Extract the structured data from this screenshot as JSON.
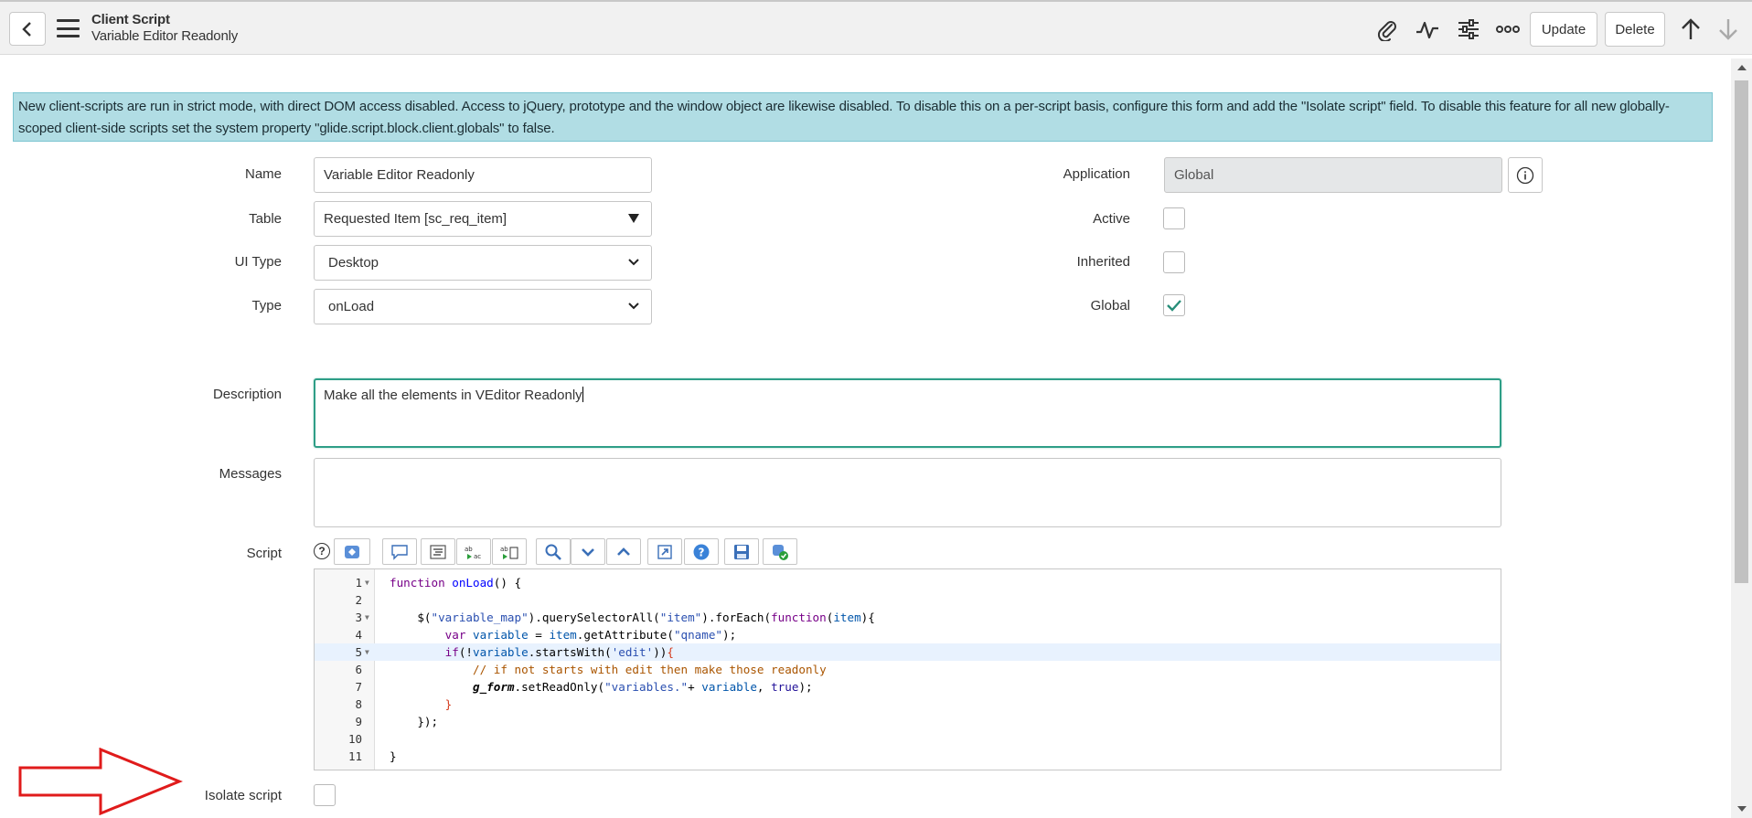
{
  "header": {
    "record_type": "Client Script",
    "record_name": "Variable Editor Readonly",
    "update_label": "Update",
    "delete_label": "Delete"
  },
  "banner": {
    "text": "New client-scripts are run in strict mode, with direct DOM access disabled. Access to jQuery, prototype and the window object are likewise disabled. To disable this on a per-script basis, configure this form and add the \"Isolate script\" field. To disable this feature for all new globally-scoped client-side scripts set the system property \"glide.script.block.client.globals\" to false."
  },
  "form": {
    "name": {
      "label": "Name",
      "value": "Variable Editor Readonly"
    },
    "table": {
      "label": "Table",
      "value": "Requested Item [sc_req_item]"
    },
    "ui_type": {
      "label": "UI Type",
      "value": "Desktop"
    },
    "type": {
      "label": "Type",
      "value": "onLoad"
    },
    "application": {
      "label": "Application",
      "value": "Global"
    },
    "active": {
      "label": "Active",
      "checked": false
    },
    "inherited": {
      "label": "Inherited",
      "checked": false
    },
    "global": {
      "label": "Global",
      "checked": true
    },
    "description": {
      "label": "Description",
      "value": "Make all the elements in VEditor Readonly"
    },
    "messages": {
      "label": "Messages",
      "value": ""
    },
    "script": {
      "label": "Script",
      "help": "?"
    },
    "isolate_script": {
      "label": "Isolate script",
      "checked": false
    }
  },
  "script_lines": [
    {
      "n": "1",
      "fold": true
    },
    {
      "n": "2",
      "fold": false
    },
    {
      "n": "3",
      "fold": true
    },
    {
      "n": "4",
      "fold": false
    },
    {
      "n": "5",
      "fold": true
    },
    {
      "n": "6",
      "fold": false
    },
    {
      "n": "7",
      "fold": false
    },
    {
      "n": "8",
      "fold": false
    },
    {
      "n": "9",
      "fold": false
    },
    {
      "n": "10",
      "fold": false
    },
    {
      "n": "11",
      "fold": false
    }
  ],
  "code_tokens": {
    "l1": {
      "kw": "function",
      "fn": "onLoad",
      "rest": "() {"
    },
    "l3": {
      "a": "$(",
      "s1": "\"variable_map\"",
      "b": ").querySelectorAll(",
      "s2": "\"item\"",
      "c": ").forEach(",
      "kw": "function",
      "d": "(",
      "v": "item",
      "e": "){"
    },
    "l4": {
      "kw": "var",
      "v": "variable",
      "a": " = ",
      "v2": "item",
      "b": ".getAttribute(",
      "s": "\"qname\"",
      "c": ");"
    },
    "l5": {
      "kw": "if",
      "a": "(!",
      "v": "variable",
      "b": ".startsWith(",
      "s": "'edit'",
      "c": "))",
      "br": "{"
    },
    "l6": {
      "cm": "// if not starts with edit then make those readonly"
    },
    "l7": {
      "g": "g_form",
      "a": ".setReadOnly(",
      "s": "\"variables.\"",
      "b": "+ ",
      "v": "variable",
      "c": ", ",
      "at": "true",
      "d": ");"
    },
    "l8": {
      "br": "}"
    },
    "l9": {
      "a": "});"
    },
    "l11": {
      "a": "}"
    }
  },
  "colors": {
    "banner_bg": "#b1dde4",
    "focus_border": "#2e9e87",
    "arrow_red": "#e01b1b",
    "check_green": "#278e79"
  },
  "icons": [
    "back-icon",
    "menu-icon",
    "attachment-icon",
    "activity-icon",
    "settings-icon",
    "more-icon",
    "arrow-up-icon",
    "arrow-down-icon",
    "info-icon"
  ]
}
